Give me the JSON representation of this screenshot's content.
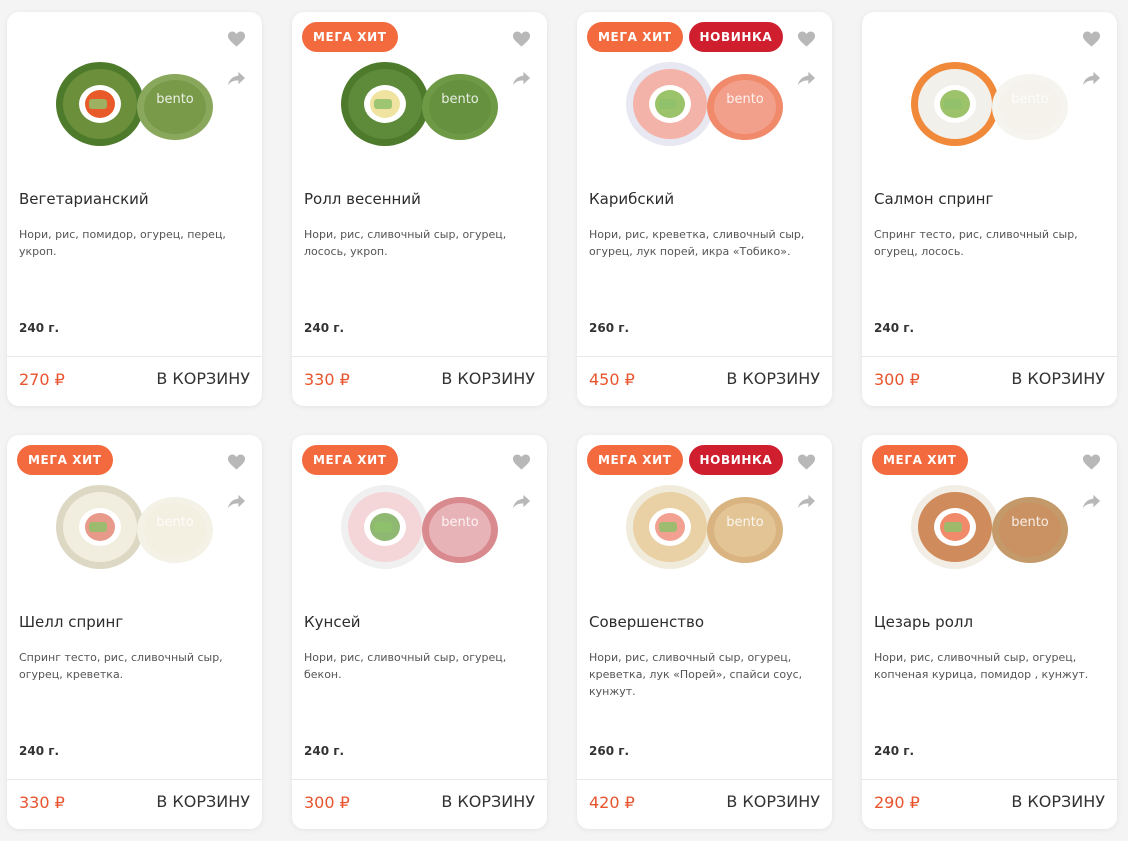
{
  "colors": {
    "badge_hit": "#f26a3d",
    "badge_new": "#cf1f2e",
    "price": "#e8542d",
    "icon": "#b8b8b8"
  },
  "cart_label": "В КОРЗИНУ",
  "icons": {
    "favorite": "heart-icon",
    "share": "share-icon"
  },
  "products": [
    {
      "name": "Вегетарианский",
      "description": "Нори, рис, помидор, огурец, перец, укроп.",
      "weight": "240 г.",
      "price": "270 ₽",
      "badges": [],
      "image": "roll-veggie-image"
    },
    {
      "name": "Ролл весенний",
      "description": "Нори, рис, сливочный сыр, огурец, лосось, укроп.",
      "weight": "240 г.",
      "price": "330 ₽",
      "badges": [
        "МЕГА ХИТ"
      ],
      "image": "roll-spring-image"
    },
    {
      "name": "Карибский",
      "description": "Нори, рис, креветка, сливочный сыр, огурец, лук порей, икра «Тобико».",
      "weight": "260 г.",
      "price": "450 ₽",
      "badges": [
        "МЕГА ХИТ",
        "НОВИНКА"
      ],
      "image": "roll-caribbean-image"
    },
    {
      "name": "Салмон спринг",
      "description": "Спринг тесто, рис, сливочный сыр, огурец, лосось.",
      "weight": "240 г.",
      "price": "300 ₽",
      "badges": [],
      "image": "roll-salmon-spring-image"
    },
    {
      "name": "Шелл спринг",
      "description": "Спринг тесто, рис, сливочный сыр, огурец, креветка.",
      "weight": "240 г.",
      "price": "330 ₽",
      "badges": [
        "МЕГА ХИТ"
      ],
      "image": "roll-shell-spring-image"
    },
    {
      "name": "Кунсей",
      "description": "Нори, рис, сливочный сыр, огурец, бекон.",
      "weight": "240 г.",
      "price": "300 ₽",
      "badges": [
        "МЕГА ХИТ"
      ],
      "image": "roll-kunsei-image"
    },
    {
      "name": "Совершенство",
      "description": "Нори, рис, сливочный сыр, огурец, креветка, лук «Порей», спайси соус, кунжут.",
      "weight": "260 г.",
      "price": "420 ₽",
      "badges": [
        "МЕГА ХИТ",
        "НОВИНКА"
      ],
      "image": "roll-perfection-image"
    },
    {
      "name": "Цезарь ролл",
      "description": "Нори, рис, сливочный сыр, огурец, копченая курица, помидор , кунжут.",
      "weight": "240 г.",
      "price": "290 ₽",
      "badges": [
        "МЕГА ХИТ"
      ],
      "image": "roll-caesar-image"
    }
  ]
}
